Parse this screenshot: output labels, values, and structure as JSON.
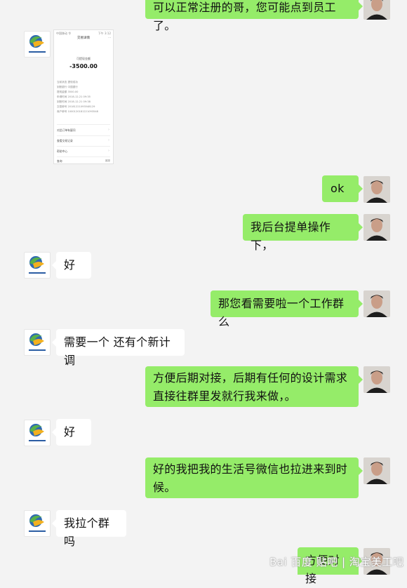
{
  "messages": [
    {
      "side": "right",
      "text": "可以正常注册的哥，您可能点到员工了。"
    },
    {
      "side": "left",
      "type": "image"
    },
    {
      "side": "right",
      "text": "ok"
    },
    {
      "side": "right",
      "text": "我后台提单操作下，"
    },
    {
      "side": "left",
      "text": "好"
    },
    {
      "side": "right",
      "text": "那您看需要啦一个工作群么"
    },
    {
      "side": "left",
      "text": "需要一个 还有个新计调"
    },
    {
      "side": "right",
      "text": "方便后期对接，后期有任何的设计需求直接往群里发就行我来做，。"
    },
    {
      "side": "left",
      "text": "好"
    },
    {
      "side": "right",
      "text": "好的我把我的生活号微信也拉进来到时候。"
    },
    {
      "side": "left",
      "text": "我拉个群吗"
    },
    {
      "side": "right",
      "text": "方便对接"
    }
  ],
  "shared_screenshot": {
    "status_left": "中国移动 令",
    "status_right": "下午 3:12",
    "header": "交易详情",
    "header_right": "···",
    "subtitle": " ",
    "label": "可提现金额",
    "amount": "-3500.00",
    "rows": [
      "当前状态    提现成功",
      "到账银行    中国银行",
      "提现金额    3500.00",
      "申请时间    2018-12-21 09:35",
      "到账时间    2018-12-21 09:38",
      "交易单号    20181221093548129",
      "商户单号    1000120181221093548"
    ],
    "links": [
      "对此订单有疑问",
      "查看交易记录",
      "帮助中心"
    ],
    "footer_left": "查询",
    "footer_right": "客服"
  },
  "watermark": "Bai 百度 贴吧 | 淘宝美工吧",
  "colors": {
    "background": "#f3f3f3",
    "right_bubble": "#95ec69",
    "left_bubble": "#ffffff"
  }
}
